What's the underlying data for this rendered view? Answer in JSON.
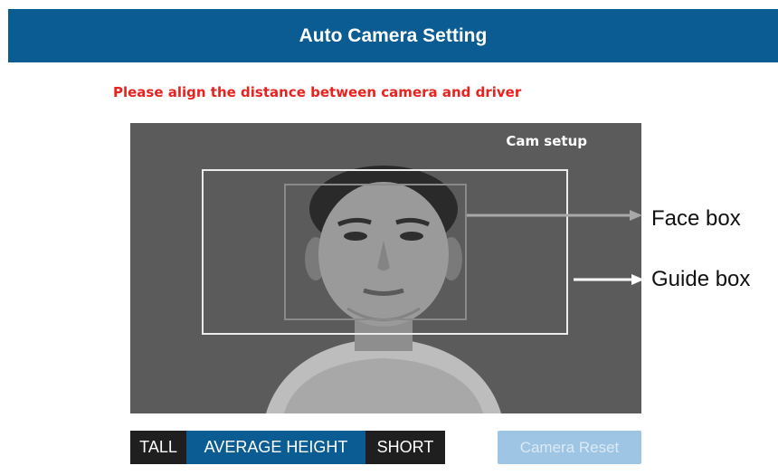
{
  "header": {
    "title": "Auto Camera Setting"
  },
  "instruction": {
    "text": "Please align the distance between camera and driver"
  },
  "camera": {
    "overlay_label": "Cam setup"
  },
  "annotations": {
    "face_box_label": "Face box",
    "guide_box_label": "Guide box"
  },
  "height_selector": {
    "options": [
      {
        "label": "TALL",
        "selected": false
      },
      {
        "label": "AVERAGE HEIGHT",
        "selected": true
      },
      {
        "label": "SHORT",
        "selected": false
      }
    ]
  },
  "actions": {
    "camera_reset_label": "Camera Reset",
    "camera_reset_enabled": false
  },
  "colors": {
    "header_bg": "#0a5c93",
    "instruction_text": "#e8231f",
    "segment_selected": "#0a5c93",
    "segment_unselected": "#1f1f1f",
    "reset_button_disabled": "#9ec6e4"
  },
  "icons": {
    "face_arrow": "right-arrow-icon",
    "guide_arrow": "right-arrow-icon"
  }
}
